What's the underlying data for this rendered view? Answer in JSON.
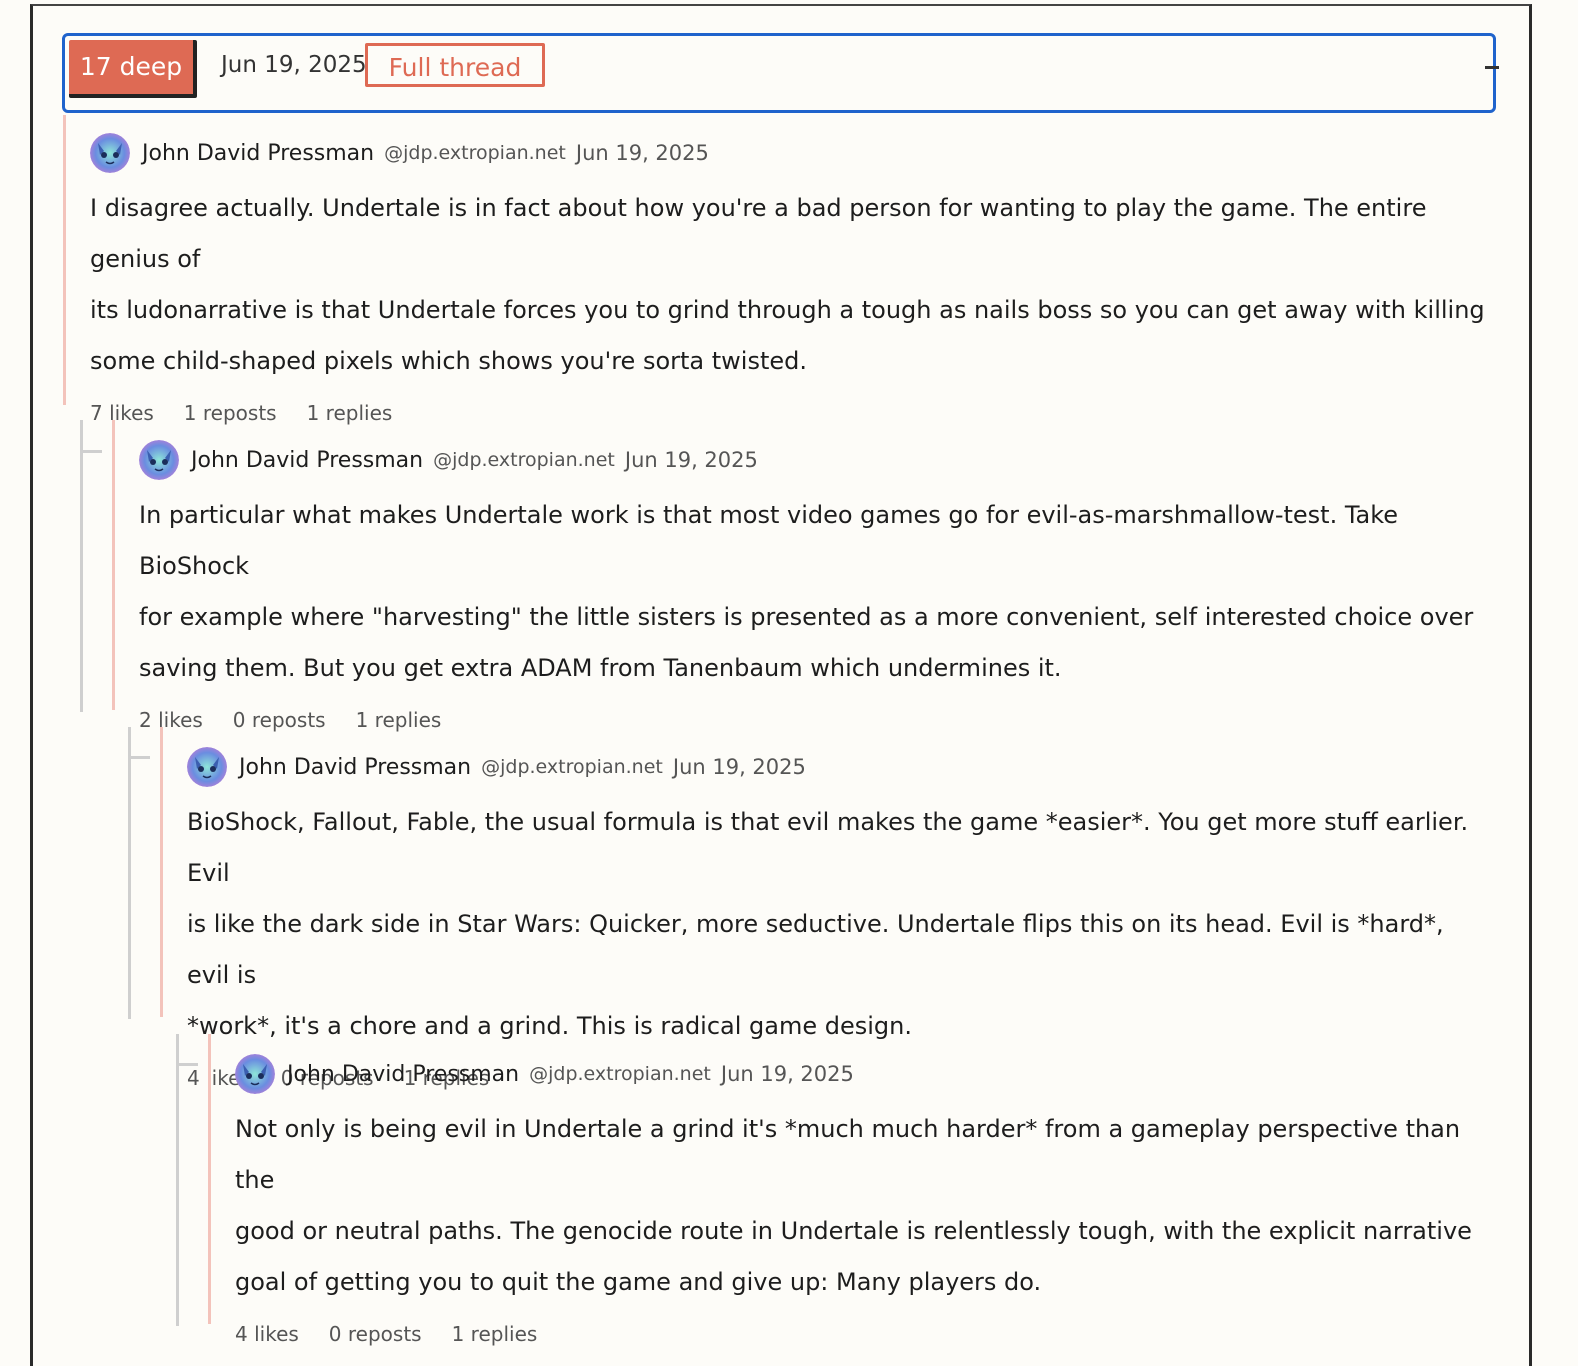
{
  "header": {
    "depth_badge": "17 deep",
    "date": "Jun 19, 2025",
    "full_thread_label": "Full thread"
  },
  "posts": [
    {
      "author": "John David Pressman",
      "handle": "@jdp.extropian.net",
      "date": "Jun 19, 2025",
      "lines": [
        "I disagree actually. Undertale is in fact about how you're a bad person for wanting to play the game. The entire genius of",
        "its ludonarrative is that Undertale forces you to grind through a tough as nails boss so you can get away with killing",
        "some child-shaped pixels which shows you're sorta twisted."
      ],
      "likes": "7 likes",
      "reposts": "1 reposts",
      "replies": "1 replies"
    },
    {
      "author": "John David Pressman",
      "handle": "@jdp.extropian.net",
      "date": "Jun 19, 2025",
      "lines": [
        "In particular what makes Undertale work is that most video games go for evil-as-marshmallow-test. Take BioShock",
        "for example where \"harvesting\" the little sisters is presented as a more convenient, self interested choice over",
        "saving them. But you get extra ADAM from Tanenbaum which undermines it."
      ],
      "likes": "2 likes",
      "reposts": "0 reposts",
      "replies": "1 replies"
    },
    {
      "author": "John David Pressman",
      "handle": "@jdp.extropian.net",
      "date": "Jun 19, 2025",
      "lines": [
        "BioShock, Fallout, Fable, the usual formula is that evil makes the game *easier*. You get more stuff earlier. Evil",
        "is like the dark side in Star Wars: Quicker, more seductive. Undertale flips this on its head. Evil is *hard*, evil is",
        "*work*, it's a chore and a grind. This is radical game design."
      ],
      "likes": "4 likes",
      "reposts": "0 reposts",
      "replies": "1 replies"
    },
    {
      "author": "John David Pressman",
      "handle": "@jdp.extropian.net",
      "date": "Jun 19, 2025",
      "lines": [
        "Not only is being evil in Undertale a grind it's *much much harder* from a gameplay perspective than the",
        "good or neutral paths. The genocide route in Undertale is relentlessly tough, with the explicit narrative",
        "goal of getting you to quit the game and give up: Many players do."
      ],
      "likes": "4 likes",
      "reposts": "0 reposts",
      "replies": "1 replies"
    }
  ],
  "icons": {
    "avatar": "cat-avatar-icon"
  },
  "colors": {
    "accent": "#de6a54",
    "header_border": "#1f63cc",
    "thread_border": "#f3c3bb",
    "thread_line": "#cfcfcf",
    "background": "#fdfcf8"
  }
}
